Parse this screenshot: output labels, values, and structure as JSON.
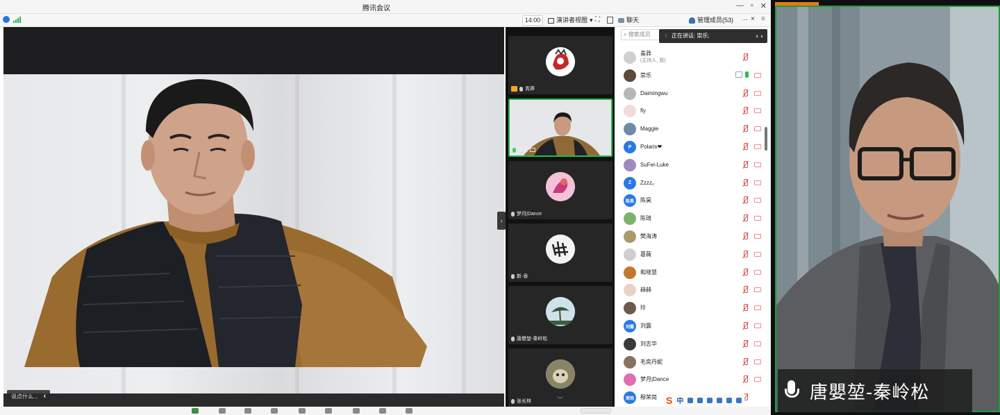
{
  "window": {
    "title": "腾讯会议",
    "controls": [
      "—",
      "▫",
      "✕"
    ]
  },
  "toolbar": {
    "time": "14:00",
    "view_label": "演讲者视图",
    "chat_label": "聊天",
    "members_label": "管理成员(53)",
    "more": "···",
    "close": "×",
    "menu": "≡"
  },
  "main_video": {
    "say_placeholder": "说点什么...",
    "collapse": "‹"
  },
  "thumbnails": [
    {
      "name": "青莽",
      "host": true,
      "mic_on": false
    },
    {
      "name": "崇乐",
      "host": false,
      "mic_on": true,
      "sharing": true
    },
    {
      "name": "梦月|Dance",
      "host": false,
      "mic_on": false
    },
    {
      "name": "新·香",
      "host": false,
      "mic_on": false
    },
    {
      "name": "唐嬰堃-秦岭松",
      "host": false,
      "mic_on": false
    },
    {
      "name": "张长林",
      "host": false,
      "mic_on": false
    }
  ],
  "panel": {
    "search_placeholder": "搜索成员",
    "speaking_label": "正在讲话: 崇乐;",
    "members": [
      {
        "name": "青莽",
        "sub": "(主持人, 我)",
        "avatar_color": "#d0d0d0",
        "mic": "off",
        "cam": false
      },
      {
        "name": "崇乐",
        "sub": "",
        "avatar_color": "#5a4a3a",
        "mic": "on",
        "cam": true,
        "screen": true
      },
      {
        "name": "Daimingwu",
        "sub": "",
        "avatar_color": "#b7b7b7",
        "mic": "off",
        "cam": true
      },
      {
        "name": "fly",
        "sub": "",
        "avatar_color": "#f0dcdc",
        "mic": "off",
        "cam": true
      },
      {
        "name": "Maggie",
        "sub": "",
        "avatar_color": "#6f8aa8",
        "mic": "off",
        "cam": true
      },
      {
        "name": "Polaris❤",
        "sub": "",
        "avatar_color": "#2a78e6",
        "initial": "P",
        "mic": "off",
        "cam": true
      },
      {
        "name": "SuFei-Luke",
        "sub": "",
        "avatar_color": "#9e8ac0",
        "mic": "off",
        "cam": true
      },
      {
        "name": "Zzzz。",
        "sub": "",
        "avatar_color": "#2a78e6",
        "initial": "Z",
        "mic": "off",
        "cam": true
      },
      {
        "name": "陈昊",
        "sub": "",
        "avatar_color": "#2a78e6",
        "initial": "陈昊",
        "mic": "off",
        "cam": true
      },
      {
        "name": "陈琦",
        "sub": "",
        "avatar_color": "#7db36a",
        "mic": "off",
        "cam": true
      },
      {
        "name": "樊海涛",
        "sub": "",
        "avatar_color": "#a99a6c",
        "mic": "off",
        "cam": true
      },
      {
        "name": "葛薇",
        "sub": "",
        "avatar_color": "#cfcfcf",
        "mic": "off",
        "cam": true
      },
      {
        "name": "和晓慧",
        "sub": "",
        "avatar_color": "#c27a2a",
        "mic": "off",
        "cam": true
      },
      {
        "name": "赫赫",
        "sub": "",
        "avatar_color": "#e8d2c6",
        "mic": "off",
        "cam": true
      },
      {
        "name": "玲",
        "sub": "",
        "avatar_color": "#6d5a48",
        "mic": "off",
        "cam": true
      },
      {
        "name": "刘露",
        "sub": "",
        "avatar_color": "#2a78e6",
        "initial": "刘露",
        "mic": "off",
        "cam": true
      },
      {
        "name": "刘志华",
        "sub": "",
        "avatar_color": "#3a3a3a",
        "mic": "off",
        "cam": true
      },
      {
        "name": "毛奕丹妮",
        "sub": "",
        "avatar_color": "#8a7060",
        "mic": "off",
        "cam": true
      },
      {
        "name": "梦月|Dance",
        "sub": "",
        "avatar_color": "#e06fb0",
        "mic": "off",
        "cam": true
      },
      {
        "name": "穆荣岗",
        "sub": "",
        "avatar_color": "#2a78e6",
        "initial": "荣岗",
        "mic": "off",
        "cam": false
      }
    ],
    "ime_s": "S",
    "ime_zh": "中"
  },
  "camera": {
    "speaker_name": "唐嬰堃-秦岭松"
  },
  "colors": {
    "accent_green": "#1e9c3c",
    "brand_blue": "#2a78e6",
    "mic_on": "#3fcf5e",
    "mic_off": "#d05050"
  }
}
